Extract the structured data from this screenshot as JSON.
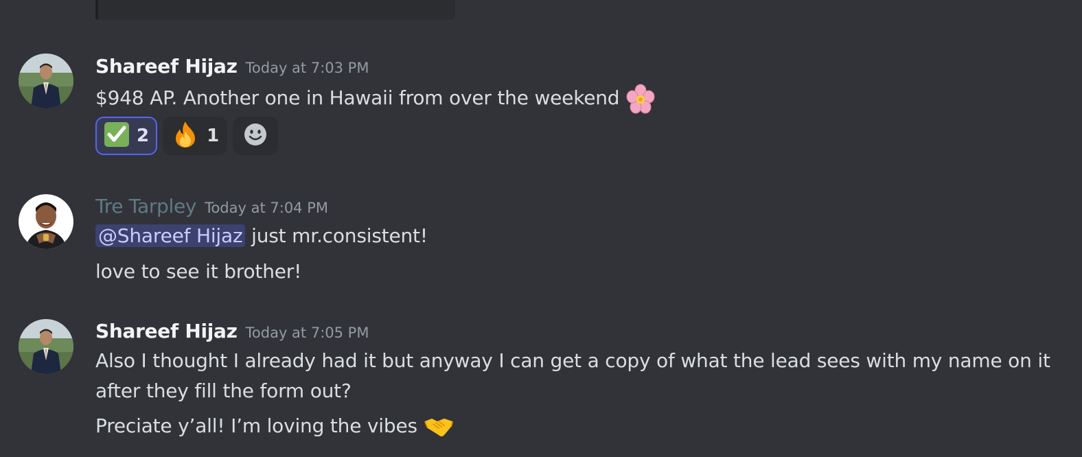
{
  "messages": [
    {
      "author": "Shareef Hijaz",
      "timestamp": "Today at 7:03 PM",
      "lines": [
        "$948 AP. Another one in Hawaii from over the weekend"
      ],
      "line_emoji": "cherry-blossom",
      "reactions": [
        {
          "emoji": "white-check-mark",
          "count": "2",
          "me": true
        },
        {
          "emoji": "fire",
          "count": "1",
          "me": false
        }
      ],
      "add_reaction_icon": "smiley-icon"
    },
    {
      "author": "Tre Tarpley",
      "timestamp": "Today at 7:04 PM",
      "mention": "@Shareef Hijaz",
      "lines": [
        " just mr.consistent!",
        "love to see it brother!"
      ]
    },
    {
      "author": "Shareef Hijaz",
      "timestamp": "Today at 7:05 PM",
      "lines": [
        "Also I thought I already had it but anyway I can get a copy of what the lead sees with my name on it",
        "after they fill the form out?",
        "Preciate y’all! I’m loving the vibes"
      ],
      "line_emoji": "handshake"
    }
  ],
  "colors": {
    "background": "#313338",
    "text": "#dbdee1",
    "muted": "#949ba4",
    "accent": "#5865f2",
    "tre_name": "#607a86"
  }
}
